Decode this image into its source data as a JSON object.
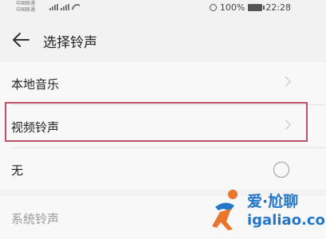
{
  "status_bar": {
    "carrier_1": "中国联通",
    "carrier_2": "中国联通",
    "battery": "100%",
    "time": "22:28",
    "icons": [
      "signal-icon",
      "signal-icon",
      "wifi-icon",
      "alarm-icon",
      "battery-icon"
    ]
  },
  "header": {
    "title": "选择铃声",
    "back_icon": "back-arrow-icon"
  },
  "list": {
    "items": [
      {
        "label": "本地音乐",
        "accessory": "chevron-right-icon"
      },
      {
        "label": "视频铃声",
        "accessory": "chevron-right-icon",
        "highlighted": true
      },
      {
        "label": "无",
        "accessory": "radio-button",
        "selected": false
      }
    ]
  },
  "section": {
    "label": "系统铃声"
  },
  "colors": {
    "background": "#f2f2f2",
    "row_background": "#f8f8f8",
    "highlight_border": "#c05068",
    "watermark": "#2476c8"
  },
  "watermark": {
    "name": "爱·尬聊",
    "url": "igaliao.com"
  }
}
